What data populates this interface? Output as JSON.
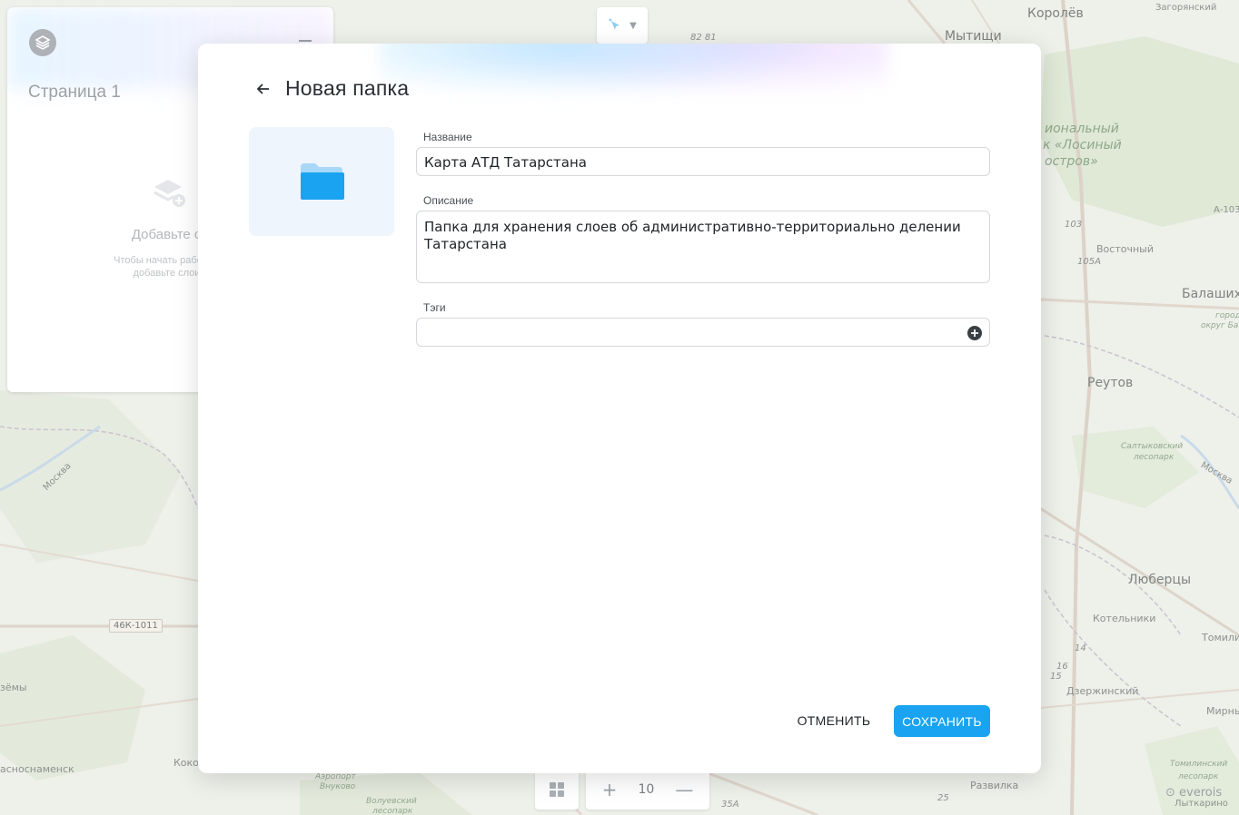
{
  "map": {
    "labels": {
      "korolev": "Королёв",
      "zagoryansky": "Загорянский",
      "mytishchi": "Мытищи",
      "park_line1": "иональный",
      "park_line2": "к «Лосиный",
      "park_line3": "остров»",
      "vostochny": "Восточный",
      "balashikha": "Балаших",
      "gorod_okrug1": "город",
      "gorod_okrug2": "округ Ба",
      "reutov": "Реутов",
      "saltykovsky1": "Салтыковский",
      "saltykovsky2": "лесопарк",
      "moskva_right": "Москва",
      "moskva_left": "Москва",
      "lyubertsy": "Люберцы",
      "kotelniki": "Котельники",
      "tomilino": "Томили",
      "dzerzhinsky": "Дзержинский",
      "mirny": "Мирны",
      "tomilinsky1": "Томилинский",
      "tomilinsky2": "лесопарк",
      "razvilka": "Развилка",
      "lytkarino": "Лыткарино",
      "vyazemy": "зёмы",
      "krasnoznamensk": "асноснаменск",
      "koko": "Коко",
      "airport1": "Аэропорт",
      "airport2": "Внуково",
      "voluevsky1": "Волуевский",
      "voluevsky2": "лесопарк",
      "a103": "А-103",
      "r103": "103",
      "r105a": "105А",
      "r35a": "35А",
      "r82": "82 81",
      "r25": "25",
      "r14": "14",
      "r16": "16",
      "r15": "15"
    },
    "road_badge": "46К-1011",
    "attribution": "everois"
  },
  "side_panel": {
    "title": "Страница 1",
    "empty_title": "Добавьте сл",
    "empty_desc_line1": "Чтобы начать работу с п",
    "empty_desc_line2": "добавьте слои в"
  },
  "zoom": {
    "plus": "+",
    "level": "10",
    "minus": "—"
  },
  "modal": {
    "title": "Новая папка",
    "name_label": "Название",
    "name_value": "Карта АТД Татарстана",
    "description_label": "Описание",
    "description_value": "Папка для хранения слоев об административно-территориально делении Татарстана",
    "tags_label": "Тэги",
    "tags_value": "",
    "cancel_label": "ОТМЕНИТЬ",
    "save_label": "СОХРАНИТЬ"
  },
  "colors": {
    "accent": "#1aa3f0",
    "folder_fill": "#1aa3f0",
    "folder_tab": "#a9d7f7",
    "thumb_bg": "#eef5fd"
  }
}
